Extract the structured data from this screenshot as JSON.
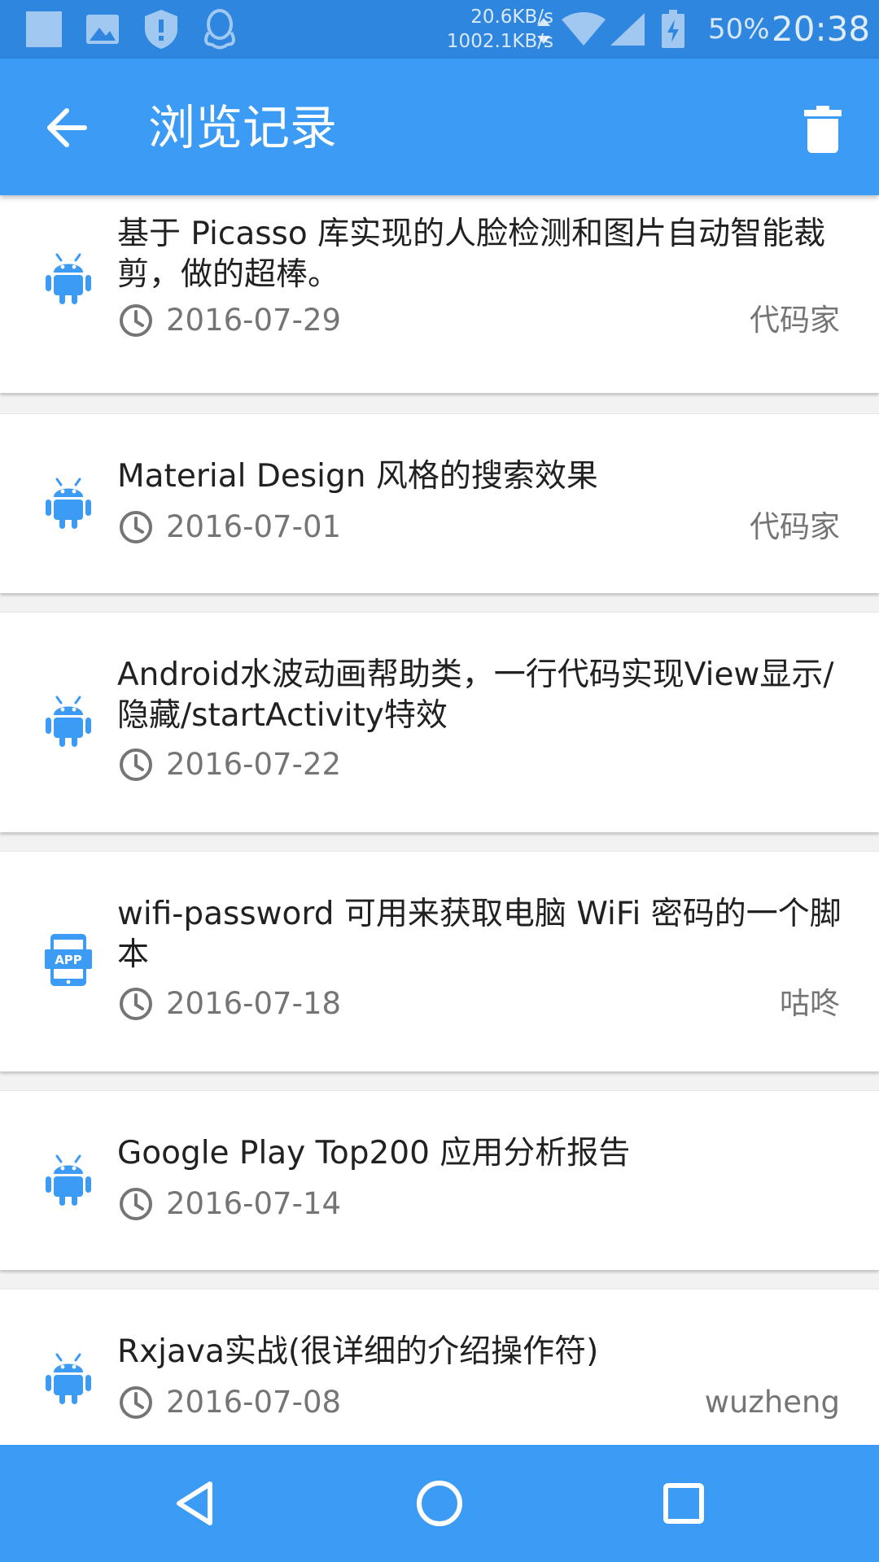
{
  "status_bar": {
    "net_up": "20.6KB/s",
    "net_down": "1002.1KB/s",
    "battery": "50%",
    "time": "20:38",
    "icons": [
      "image-icon",
      "gallery-icon",
      "shield-icon",
      "qq-icon",
      "wifi-icon",
      "cell-signal-icon",
      "battery-icon"
    ]
  },
  "app_bar": {
    "title": "浏览记录",
    "back_icon": "arrow-left-icon",
    "delete_icon": "trash-icon",
    "color": "#3C9BF5"
  },
  "items": [
    {
      "icon": "android-icon",
      "title": "基于 Picasso 库实现的人脸检测和图片自动智能裁剪，做的超棒。",
      "date": "2016-07-29",
      "author": "代码家"
    },
    {
      "icon": "android-icon",
      "title": "Material Design 风格的搜索效果",
      "date": "2016-07-01",
      "author": "代码家"
    },
    {
      "icon": "android-icon",
      "title": "Android水波动画帮助类，一行代码实现View显示/隐藏/startActivity特效",
      "date": "2016-07-22",
      "author": ""
    },
    {
      "icon": "app-icon",
      "title": "wifi-password 可用来获取电脑 WiFi 密码的一个脚本",
      "date": "2016-07-18",
      "author": "咕咚"
    },
    {
      "icon": "android-icon",
      "title": "Google Play Top200 应用分析报告",
      "date": "2016-07-14",
      "author": ""
    },
    {
      "icon": "android-icon",
      "title": "Rxjava实战(很详细的介绍操作符)",
      "date": "2016-07-08",
      "author": "wuzheng"
    }
  ],
  "nav_bar": {
    "icons": [
      "back-triangle-icon",
      "home-circle-icon",
      "recents-square-icon"
    ]
  },
  "colors": {
    "primary": "#3C9BF5",
    "status_bar": "#2E86DF",
    "icon_blue": "#3C9BF5",
    "secondary_text": "#757575"
  }
}
